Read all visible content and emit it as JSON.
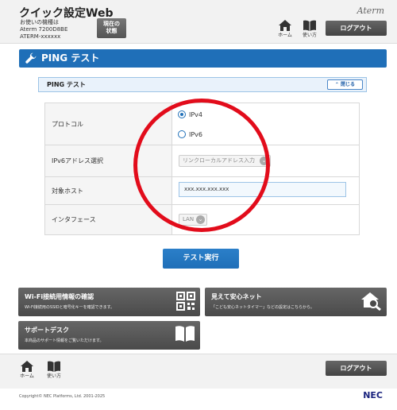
{
  "header": {
    "app_title": "クイック設定Web",
    "device_line1": "お使いの機種は",
    "device_line2": "Aterm 7200D8BE",
    "device_line3": "ATERM-xxxxxx",
    "status_line1": "現在の",
    "status_line2": "状態",
    "brand": "Aterm",
    "home_label": "ホーム",
    "guide_label": "使い方",
    "logout_label": "ログアウト"
  },
  "section": {
    "title": "PING テスト"
  },
  "subpanel": {
    "title": "PING テスト",
    "close_label": "閉じる"
  },
  "form": {
    "protocol_label": "プロトコル",
    "ipv4_label": "IPv4",
    "ipv6_label": "IPv6",
    "selected_protocol": "IPv4",
    "ipv6_address_label": "IPv6アドレス選択",
    "ipv6_address_value": "リンクローカルアドレス入力",
    "target_host_label": "対象ホスト",
    "target_host_value": "xxx.xxx.xxx.xxx",
    "interface_label": "インタフェース",
    "interface_value": "LAN"
  },
  "actions": {
    "execute_label": "テスト実行"
  },
  "tiles": [
    {
      "title": "Wi-Fi接続用情報の確認",
      "desc": "Wi-Fi接続用のSSIDと暗号化キーを確認できます。",
      "icon": "qr-code-icon"
    },
    {
      "title": "見えて安心ネット",
      "desc": "「こども安心ネットタイマー」などの設定はこちらから。",
      "icon": "home-search-icon"
    },
    {
      "title": "サポートデスク",
      "desc": "本商品のサポート情報をご覧いただけます。",
      "icon": "book-icon"
    }
  ],
  "footer": {
    "home_label": "ホーム",
    "guide_label": "使い方",
    "logout_label": "ログアウト",
    "copyright": "Copyright© NEC Platforms, Ltd. 2001-2025",
    "brand": "NEC"
  },
  "colors": {
    "accent": "#1f6fb8",
    "annotation": "#e20c1b",
    "tile": "#555555"
  }
}
